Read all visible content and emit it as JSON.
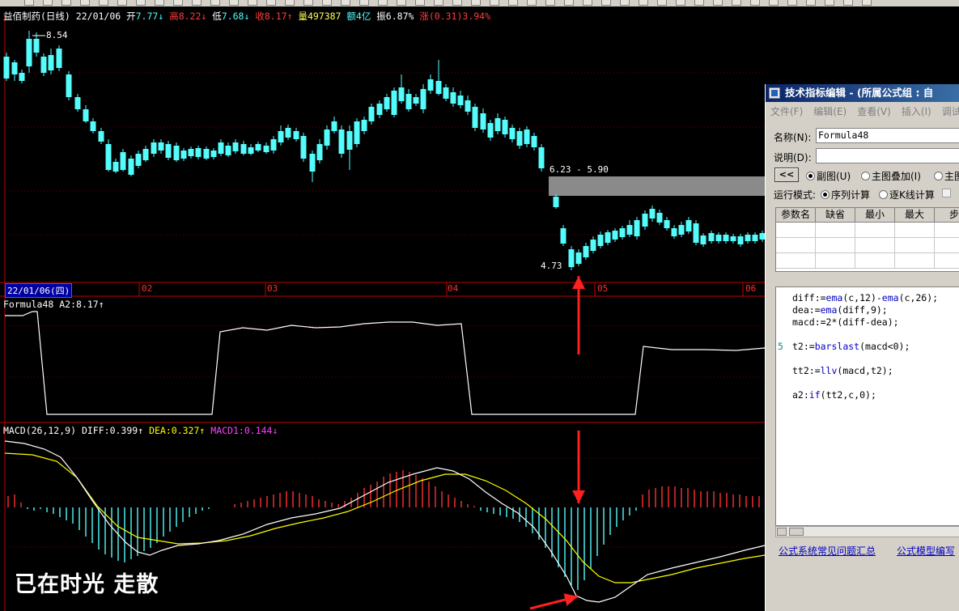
{
  "main": {
    "stock": "益佰制药(日线)",
    "date": "22/01/06",
    "open_label": "开",
    "open": "7.77",
    "open_arrow": "↓",
    "high_label": "高",
    "high": "8.22",
    "high_arrow": "↓",
    "low_label": "低",
    "low": "7.68",
    "low_arrow": "↓",
    "close_label": "收",
    "close": "8.17",
    "close_arrow": "↑",
    "vol_label": "量",
    "vol": "497387",
    "amount_label": "额",
    "amount": "4亿",
    "amp_label": "振",
    "amp": "6.87%",
    "chg_label": "涨",
    "chg": "(0.31)3.94%"
  },
  "labels": {
    "high_price": "8.54",
    "low_price": "4.73",
    "gap_range": "6.23 - 5.90"
  },
  "date_axis": {
    "current": "22/01/06(四)",
    "ticks": [
      "02",
      "03",
      "04",
      "05",
      "06"
    ]
  },
  "formula_panel": {
    "name": "Formula48",
    "key": "A2:",
    "value": "8.17",
    "arrow": "↑"
  },
  "macd_panel": {
    "name": "MACD(26,12,9)",
    "diff_label": "DIFF:",
    "diff": "0.399",
    "diff_arrow": "↑",
    "dea_label": "DEA:",
    "dea": "0.327",
    "dea_arrow": "↑",
    "macd_label": "MACD1:",
    "macd": "0.144",
    "macd_arrow": "↓"
  },
  "watermark": "已在时光 走散",
  "dialog": {
    "title": "技术指标编辑 - (所属公式组 : 自",
    "menu": [
      "文件(F)",
      "编辑(E)",
      "查看(V)",
      "插入(I)",
      "调试"
    ],
    "name_label": "名称(N):",
    "name_value": "Formula48",
    "desc_label": "说明(D):",
    "desc_value": "",
    "back_button": "<<",
    "view_options": [
      "副图(U)",
      "主图叠加(I)",
      "主图"
    ],
    "run_mode_label": "运行模式:",
    "run_modes": [
      "序列计算",
      "逐K线计算"
    ],
    "param_headers": [
      "参数名",
      "缺省",
      "最小",
      "最大",
      "步"
    ],
    "code_lines": [
      "diff:=ema(c,12)-ema(c,26);",
      "dea:=ema(diff,9);",
      "macd:=2*(diff-dea);",
      "",
      "t2:=barslast(macd<0);",
      "",
      "tt2:=llv(macd,t2);",
      "",
      "a2:if(tt2,c,0);"
    ],
    "line_number": "5",
    "links": [
      "公式系统常见问题汇总",
      "公式模型编写"
    ]
  },
  "colors": {
    "up": "#ff3c3c",
    "down": "#54fcfc",
    "accent_red": "#ff3030",
    "dea_yellow": "#ffff00",
    "macd_magenta": "#ff40ff"
  }
}
